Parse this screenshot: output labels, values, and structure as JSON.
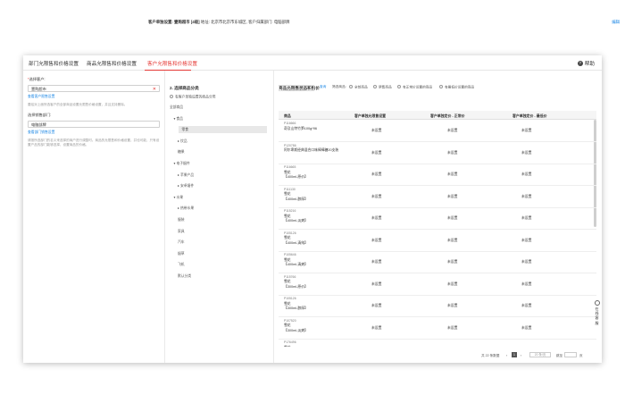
{
  "tabs": [
    {
      "label": "部门允限售和价格设置"
    },
    {
      "label": "商品允限售和价格设置"
    },
    {
      "label": "客户允限售和价格设置"
    }
  ],
  "help_label": "帮助",
  "left": {
    "customer_label": "选择客户:",
    "customer_value": "壹购超市",
    "view_customer_link": "查看客户限售设置",
    "customer_hint": "要给对上面所选客户的全部商品设置允限售价格设置，并且支持删除。",
    "dept_label": "选择销售部门:",
    "dept_value": "电脑部牌",
    "view_dept_link": "查看部门销售设置",
    "dept_hint": "请按所选部门的名义来选择的商户进行调整时。商品的允限售和价格设置，并也可能，只有设置产品的部门能够选择，设置商品的价格。"
  },
  "infobar": {
    "prefix": "客户单独设置:",
    "customer": "壹购超市 [4级]",
    "address_label": "地址:",
    "address": "北京市北京市东城区,",
    "extra": "客户归属部门: 电脑部牌",
    "edit": "编辑"
  },
  "mid": {
    "title": "2. 选择商品分类",
    "radio_label": "有客户单独设置的商品分类",
    "tree": [
      {
        "label": "全部商品",
        "indent": 0,
        "arrow": ""
      },
      {
        "label": "食品",
        "indent": 1,
        "arrow": "▾"
      },
      {
        "label": "零食",
        "indent": 3,
        "arrow": "",
        "selected": true
      },
      {
        "label": "饮品",
        "indent": 2,
        "arrow": "▸"
      },
      {
        "label": "糖果",
        "indent": 2,
        "arrow": ""
      },
      {
        "label": "电子烟件",
        "indent": 1,
        "arrow": "▾"
      },
      {
        "label": "苹果产品",
        "indent": 2,
        "arrow": "▸"
      },
      {
        "label": "安卓烟件",
        "indent": 2,
        "arrow": "▸"
      },
      {
        "label": "水果",
        "indent": 1,
        "arrow": "▾"
      },
      {
        "label": "热带水果",
        "indent": 2,
        "arrow": "▸"
      },
      {
        "label": "服装",
        "indent": 2,
        "arrow": ""
      },
      {
        "label": "家具",
        "indent": 2,
        "arrow": ""
      },
      {
        "label": "汽车",
        "indent": 2,
        "arrow": ""
      },
      {
        "label": "烟草",
        "indent": 2,
        "arrow": ""
      },
      {
        "label": "飞机",
        "indent": 2,
        "arrow": ""
      },
      {
        "label": "默认分类",
        "indent": 2,
        "arrow": ""
      }
    ]
  },
  "right": {
    "title": "商品允限售状态和售价",
    "search_placeholder": "商品名称/编码",
    "search_button": "查询",
    "filter_label": "筛选商品:",
    "filters": [
      "全部商品",
      "禁售商品",
      "有正常价设置的商品",
      "有最低价设置的商品"
    ],
    "columns": [
      "商品",
      "客户单独允限售设置",
      "客户单独定价 - 正常价",
      "客户单独定价 - 最低价"
    ],
    "rows": [
      {
        "code": "P116666",
        "name": "奇及山特竹笋100g*96",
        "name2": "",
        "c1": "未设置",
        "c2": "未设置",
        "c3": "未设置"
      },
      {
        "code": "P120786",
        "name": "阿尔卑斯经典混合口味棒棒糖20支装",
        "name2": "",
        "c1": "未设置",
        "c2": "未设置",
        "c3": "未设置"
      },
      {
        "code": "P116665",
        "name": "雪花",
        "name2": "【400ml-原价】",
        "c1": "未设置",
        "c2": "未设置",
        "c3": "未设置"
      },
      {
        "code": "P111130",
        "name": "雪花",
        "name2": "【400ml-醇厚】",
        "c1": "未设置",
        "c2": "未设置",
        "c3": "未设置"
      },
      {
        "code": "P115216",
        "name": "雪花",
        "name2": "【400ml-淡爽】",
        "c1": "未设置",
        "c2": "未设置",
        "c3": "未设置"
      },
      {
        "code": "P105126",
        "name": "雪花",
        "name2": "【400ml-清纯】",
        "c1": "未设置",
        "c2": "未设置",
        "c3": "未设置"
      },
      {
        "code": "P105646",
        "name": "雪花",
        "name2": "【400ml-清爽】",
        "c1": "未设置",
        "c2": "未设置",
        "c3": "未设置"
      },
      {
        "code": "P115766",
        "name": "雪花",
        "name2": "【300ml-原价】",
        "c1": "未设置",
        "c2": "未设置",
        "c3": "未设置"
      },
      {
        "code": "P105126",
        "name": "雪花",
        "name2": "【300ml-醇厚】",
        "c1": "未设置",
        "c2": "未设置",
        "c3": "未设置"
      },
      {
        "code": "P107520",
        "name": "雪花",
        "name2": "【300ml-淡爽】",
        "c1": "未设置",
        "c2": "未设置",
        "c3": "未设置"
      },
      {
        "code": "P176496",
        "name": "雪花",
        "name2": "【300ml-清纯】",
        "c1": "未设置",
        "c2": "未设置",
        "c3": "未设置"
      }
    ],
    "pager": {
      "total": "共 22 条数据",
      "prev": "‹",
      "current": "1",
      "next": "›",
      "page_size": "20 条/页",
      "goto_label": "跳至",
      "goto_suffix": "页"
    }
  },
  "float_widget": [
    "在",
    "线",
    "客",
    "服"
  ]
}
